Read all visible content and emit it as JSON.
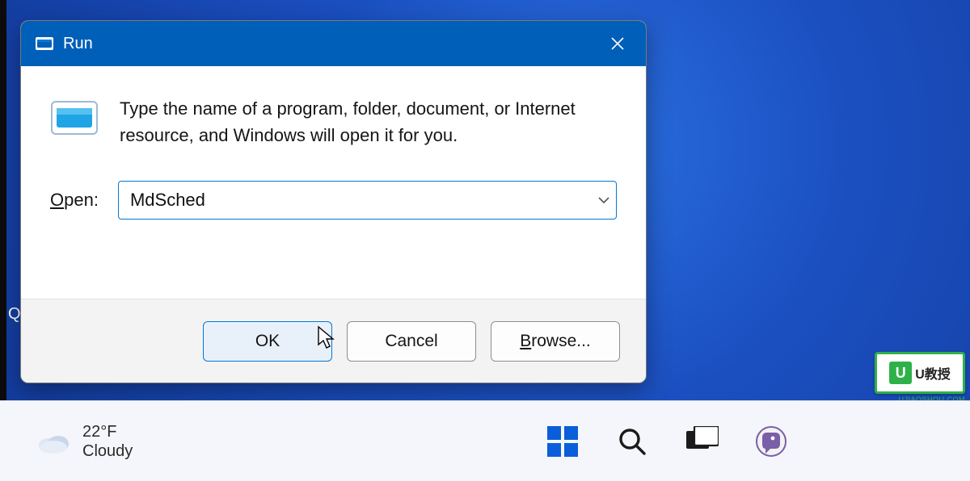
{
  "dialog": {
    "title": "Run",
    "description": "Type the name of a program, folder, document, or Internet resource, and Windows will open it for you.",
    "open_label_pre": "O",
    "open_label_post": "pen:",
    "input_value": "MdSched",
    "buttons": {
      "ok": "OK",
      "cancel": "Cancel",
      "browse_pre": "B",
      "browse_post": "rowse..."
    }
  },
  "taskbar": {
    "weather": {
      "temp": "22°F",
      "condition": "Cloudy"
    }
  },
  "misc": {
    "q": "Q"
  },
  "watermark": {
    "brand": "U教授",
    "sub": "UJIAOSHOU.COM"
  }
}
